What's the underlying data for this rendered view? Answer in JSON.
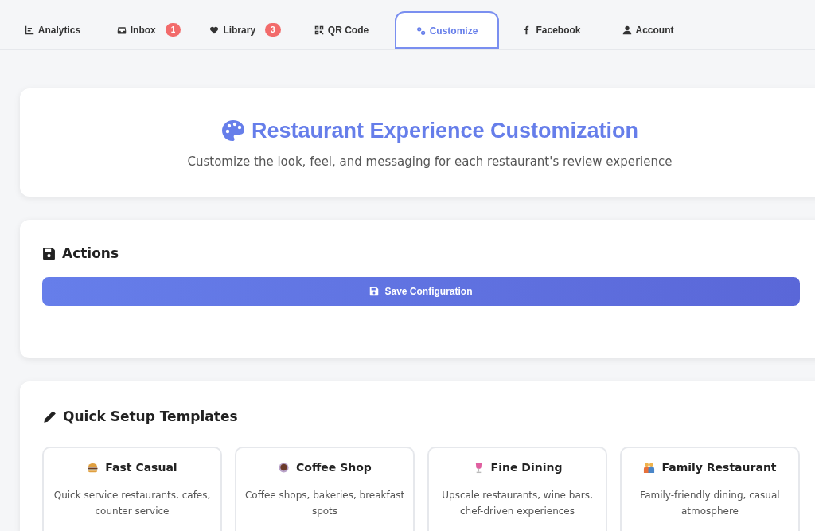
{
  "tabs": [
    {
      "label": "Analytics",
      "selected": false
    },
    {
      "label": "Inbox",
      "badge": "1",
      "selected": false
    },
    {
      "label": "Library",
      "badge": "3",
      "selected": false
    },
    {
      "label": "QR Code",
      "selected": false
    },
    {
      "label": "Customize",
      "selected": true
    },
    {
      "label": "Facebook",
      "selected": false
    },
    {
      "label": "Account",
      "selected": false
    }
  ],
  "header": {
    "title": "Restaurant Experience Customization",
    "subtitle": "Customize the look, feel, and messaging for each restaurant's review experience"
  },
  "actions": {
    "title": "Actions",
    "button": "Save Configuration"
  },
  "templates": {
    "title": "Quick Setup Templates",
    "items": [
      {
        "name": "Fast Casual",
        "description": "Quick service restaurants, cafes, counter service"
      },
      {
        "name": "Coffee Shop",
        "description": "Coffee shops, bakeries, breakfast spots"
      },
      {
        "name": "Fine Dining",
        "description": "Upscale restaurants, wine bars, chef-driven experiences"
      },
      {
        "name": "Family Restaurant",
        "description": "Family-friendly dining, casual atmosphere"
      }
    ]
  }
}
